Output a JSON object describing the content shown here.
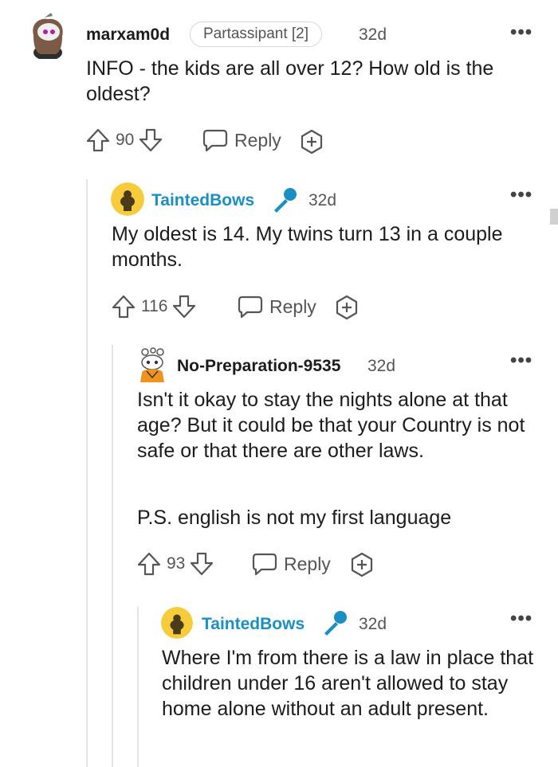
{
  "comments": [
    {
      "username": "marxam0d",
      "flair": "Partassipant [2]",
      "time": "32d",
      "body": [
        "INFO - the kids are all over 12? How old is the oldest?"
      ],
      "score": "90",
      "reply_label": "Reply",
      "avatar_icon": "snoo-avatar-purple-hair"
    },
    {
      "username": "TaintedBows",
      "time": "32d",
      "body": [
        "My oldest is 14. My twins turn 13 in a couple months."
      ],
      "score": "116",
      "reply_label": "Reply",
      "badge_icon": "microphone-icon",
      "avatar_icon": "snoo-avatar-yellow"
    },
    {
      "username": "No-Preparation-9535",
      "time": "32d",
      "body": [
        "Isn't it okay to stay the nights alone at that age? But it could be that your Country is not safe or that there are other laws.",
        "P.S. english is not my first language"
      ],
      "score": "93",
      "reply_label": "Reply",
      "avatar_icon": "snoo-avatar-orange"
    },
    {
      "username": "TaintedBows",
      "time": "32d",
      "body": [
        "Where I'm from there is a law in place that children under 16 aren't allowed to stay home alone without an adult present."
      ],
      "badge_icon": "microphone-icon",
      "avatar_icon": "snoo-avatar-yellow"
    }
  ],
  "more_icon": "more-options-icon",
  "colors": {
    "op_blue": "#1a8fc4",
    "text": "#1c1c1c",
    "muted": "#555555",
    "thread": "#e4e4e4"
  }
}
